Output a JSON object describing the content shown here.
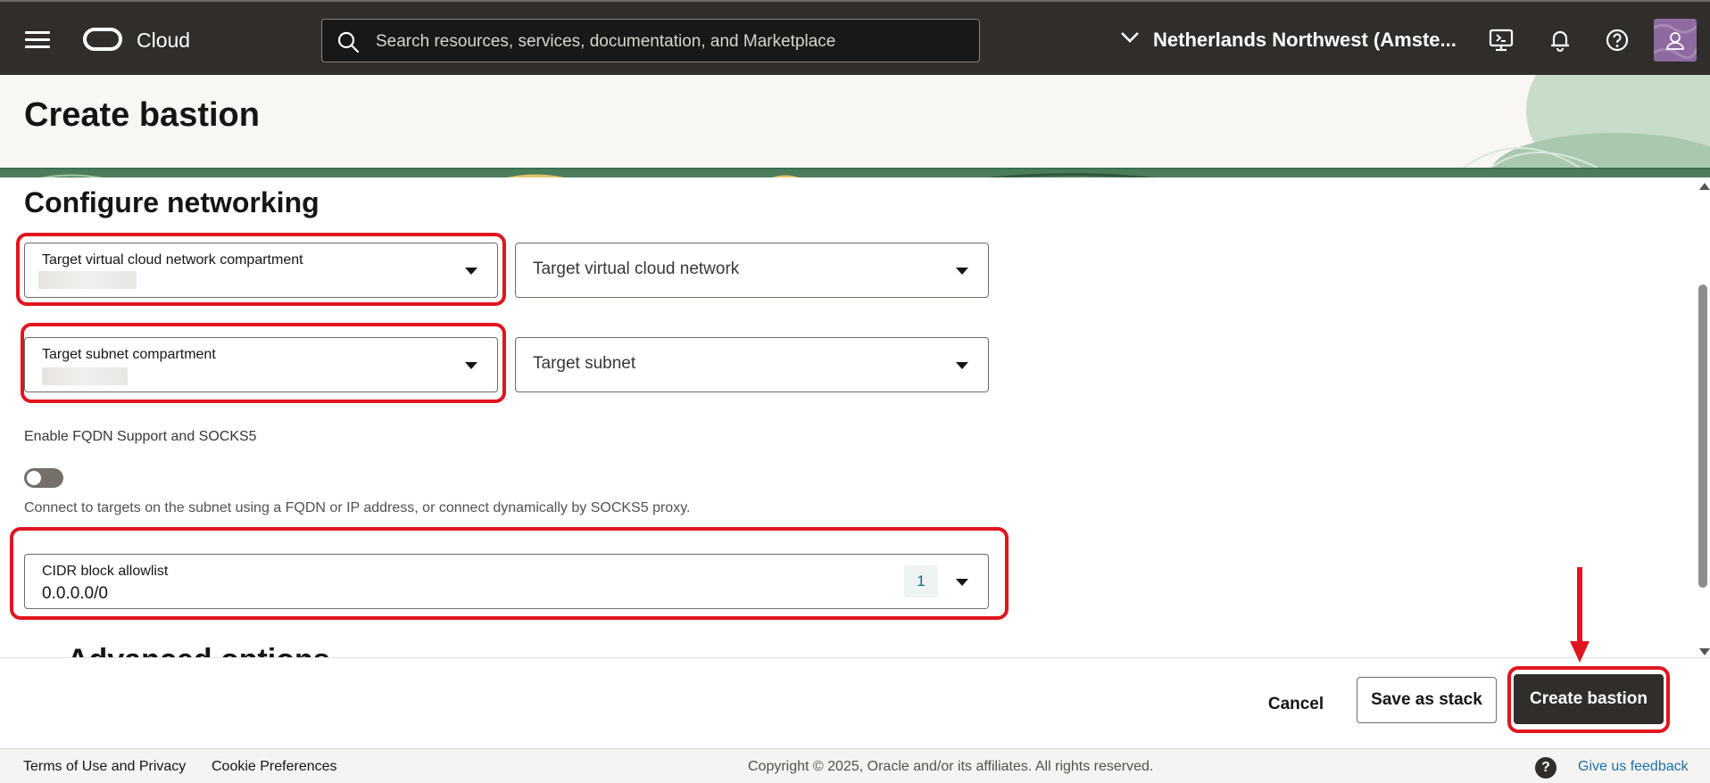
{
  "topbar": {
    "brand": "Cloud",
    "search_placeholder": "Search resources, services, documentation, and Marketplace",
    "region": "Netherlands Northwest (Amste...",
    "icons": [
      "menu-icon",
      "oracle-logo",
      "search-icon",
      "chevron-down-icon",
      "cloud-shell-icon",
      "bell-icon",
      "help-icon",
      "user-icon"
    ]
  },
  "header": {
    "title": "Create bastion"
  },
  "networking": {
    "section_title": "Configure networking",
    "vcn_compartment_label": "Target virtual cloud network compartment",
    "vcn_label": "Target virtual cloud network",
    "subnet_compartment_label": "Target subnet compartment",
    "subnet_label": "Target subnet",
    "fqdn_toggle_label": "Enable FQDN Support and SOCKS5",
    "fqdn_toggle_on": false,
    "fqdn_help": "Connect to targets on the subnet using a FQDN or IP address, or connect dynamically by SOCKS5 proxy.",
    "cidr_label": "CIDR block allowlist",
    "cidr_value": "0.0.0.0/0",
    "cidr_count": "1",
    "advanced_peek": "Advanced options"
  },
  "actions": {
    "cancel": "Cancel",
    "save_stack": "Save as stack",
    "create": "Create bastion"
  },
  "footer": {
    "terms": "Terms of Use and Privacy",
    "cookies": "Cookie Preferences",
    "copyright": "Copyright © 2025, Oracle and/or its affiliates. All rights reserved.",
    "feedback": "Give us feedback"
  },
  "colors": {
    "topbar": "#312d2a",
    "highlight": "#e0151f",
    "primary_button": "#312d2a",
    "link": "#1b6fa8"
  }
}
